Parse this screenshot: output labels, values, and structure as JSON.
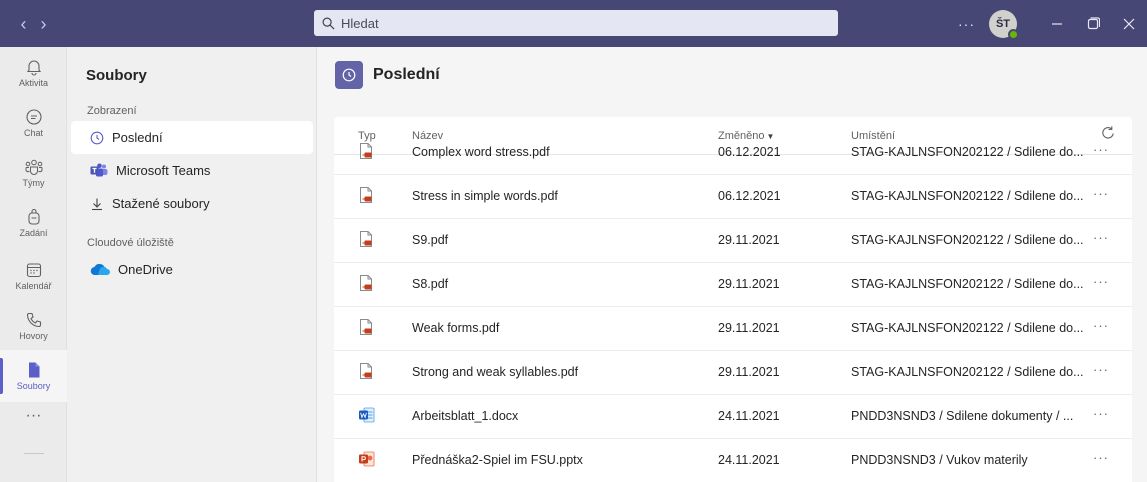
{
  "titlebar": {
    "search_placeholder": "Hledat",
    "more_label": "···",
    "avatar_initials": "ŠT",
    "presence_color": "#6bb700"
  },
  "rail": {
    "items": [
      {
        "label": "Aktivita",
        "icon": "bell-icon"
      },
      {
        "label": "Chat",
        "icon": "chat-icon"
      },
      {
        "label": "Týmy",
        "icon": "teams-icon"
      },
      {
        "label": "Zadání",
        "icon": "backpack-icon"
      },
      {
        "label": "Kalendář",
        "icon": "calendar-icon"
      },
      {
        "label": "Hovory",
        "icon": "phone-icon"
      },
      {
        "label": "Soubory",
        "icon": "file-icon",
        "active": true
      }
    ],
    "more_label": "···"
  },
  "left_panel": {
    "title": "Soubory",
    "view_section": "Zobrazení",
    "view_items": [
      {
        "label": "Poslední",
        "icon": "clock-icon",
        "selected": true
      },
      {
        "label": "Microsoft Teams",
        "icon": "teams-logo-icon"
      },
      {
        "label": "Stažené soubory",
        "icon": "download-icon"
      }
    ],
    "cloud_section": "Cloudové úložiště",
    "cloud_items": [
      {
        "label": "OneDrive",
        "icon": "onedrive-icon"
      }
    ]
  },
  "main": {
    "title": "Poslední",
    "columns": {
      "type": "Typ",
      "name": "Název",
      "modified": "Změněno",
      "location": "Umístění"
    },
    "rows": [
      {
        "type": "pdf",
        "name": "Complex word stress.pdf",
        "modified": "06.12.2021",
        "location": "STAG-KAJLNSFON202122 / Sdilene do...",
        "more": "···"
      },
      {
        "type": "pdf",
        "name": "Stress in simple words.pdf",
        "modified": "06.12.2021",
        "location": "STAG-KAJLNSFON202122 / Sdilene do...",
        "more": "···"
      },
      {
        "type": "pdf",
        "name": "S9.pdf",
        "modified": "29.11.2021",
        "location": "STAG-KAJLNSFON202122 / Sdilene do...",
        "more": "···"
      },
      {
        "type": "pdf",
        "name": "S8.pdf",
        "modified": "29.11.2021",
        "location": "STAG-KAJLNSFON202122 / Sdilene do...",
        "more": "···"
      },
      {
        "type": "pdf",
        "name": "Weak forms.pdf",
        "modified": "29.11.2021",
        "location": "STAG-KAJLNSFON202122 / Sdilene do...",
        "more": "···"
      },
      {
        "type": "pdf",
        "name": "Strong and weak syllables.pdf",
        "modified": "29.11.2021",
        "location": "STAG-KAJLNSFON202122 / Sdilene do...",
        "more": "···"
      },
      {
        "type": "docx",
        "name": "Arbeitsblatt_1.docx",
        "modified": "24.11.2021",
        "location": "PNDD3NSND3 / Sdilene dokumenty / ...",
        "more": "···"
      },
      {
        "type": "pptx",
        "name": "Přednáška2-Spiel im FSU.pptx",
        "modified": "24.11.2021",
        "location": "PNDD3NSND3 / Vukov materily",
        "more": "···"
      }
    ]
  },
  "colors": {
    "titlebar": "#464775",
    "accent": "#5b5fc7",
    "pdf": "#c43e1c",
    "word": "#185abd",
    "powerpoint": "#c43e1c"
  }
}
